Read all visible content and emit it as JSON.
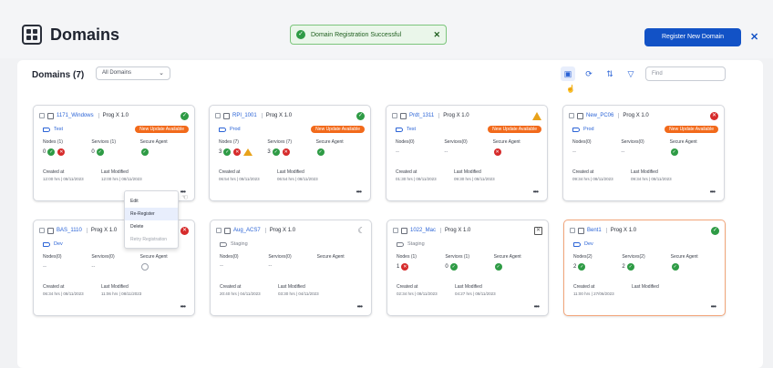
{
  "header": {
    "title": "Domains",
    "toast": "Domain Registration Successful",
    "register_label": "Register New Domain"
  },
  "toolbar": {
    "count_title": "Domains (7)",
    "filter_value": "All Domains",
    "find_placeholder": "Find"
  },
  "menu": {
    "items": [
      "Edit",
      "Re-Register",
      "Delete",
      "Retry Registration"
    ]
  },
  "labels": {
    "nodes": "Nodes",
    "services": "Services",
    "secure_agent": "Secure Agent",
    "created_at": "Created at",
    "last_modified": "Last Modified"
  },
  "cards": [
    {
      "name": "1171_Windows",
      "prog": "Prog X 1.0",
      "status": "ok",
      "tag": "Test",
      "update": "New Update Available",
      "nodes_label": "Nodes (1)",
      "services_label": "Services (1)",
      "agent_label": "Secure Agent",
      "nodes_val": "0",
      "services_val": "0",
      "created": "12:00 hrs | 08/11/2023",
      "modified": "12:00 hrs | 08/11/2023"
    },
    {
      "name": "RPI_1001",
      "prog": "Prog X 1.0",
      "status": "ok",
      "tag": "Prod",
      "update": "New Update Available",
      "nodes_label": "Nodes (7)",
      "services_label": "Services (7)",
      "agent_label": "Secure Agent",
      "nodes_val": "3",
      "services_val": "3",
      "created": "06:54 hrs | 08/11/2023",
      "modified": "06:54 hrs | 08/11/2023"
    },
    {
      "name": "Prdt_1311",
      "prog": "Prog X 1.0",
      "status": "warn",
      "tag": "Test",
      "update": "New Update Available",
      "nodes_label": "Nodes(0)",
      "services_label": "Services(0)",
      "agent_label": "Secure Agent",
      "nodes_val": "--",
      "services_val": "--",
      "created": "01:30 hrs | 08/11/2023",
      "modified": "09:30 hrs | 08/11/2023"
    },
    {
      "name": "New_PC06",
      "prog": "Prog X 1.0",
      "status": "err",
      "tag": "Prod",
      "update": "New Update Available",
      "nodes_label": "Nodes(0)",
      "services_label": "Services(0)",
      "agent_label": "Secure Agent",
      "nodes_val": "--",
      "services_val": "--",
      "created": "09:34 hrs | 08/11/2023",
      "modified": "09:34 hrs | 08/11/2023"
    },
    {
      "name": "BAS_1110",
      "prog": "Prog X 1.0",
      "status": "err",
      "tag": "Dev",
      "update": "",
      "nodes_label": "Nodes(0)",
      "services_label": "Services(0)",
      "agent_label": "Secure Agent",
      "nodes_val": "--",
      "services_val": "--",
      "created": "06:34 hrs | 08/11/2023",
      "modified": "11:06 hrs | 08/11/2023"
    },
    {
      "name": "Aug_ACS7",
      "prog": "Prog X 1.0",
      "status": "moon",
      "tag": "Staging",
      "update": "",
      "nodes_label": "Nodes(0)",
      "services_label": "Services(0)",
      "agent_label": "Secure Agent",
      "nodes_val": "--",
      "services_val": "--",
      "created": "20:40 hrs | 04/11/2023",
      "modified": "03:30 hrs | 04/11/2023"
    },
    {
      "name": "1022_Mac",
      "prog": "Prog X 1.0",
      "status": "box",
      "tag": "Staging",
      "update": "",
      "nodes_label": "Nodes (1)",
      "services_label": "Services (1)",
      "agent_label": "Secure Agent",
      "nodes_val": "1",
      "services_val": "0",
      "created": "02:34 hrs | 08/11/2023",
      "modified": "04:27 hrs | 08/11/2023"
    },
    {
      "name": "Bent1",
      "prog": "Prog X 1.0",
      "status": "ok",
      "tag": "Dev",
      "update": "",
      "nodes_label": "Nodes(2)",
      "services_label": "Services(2)",
      "agent_label": "Secure Agent",
      "nodes_val": "2",
      "services_val": "2",
      "created": "11:00 hrs | 27/06/2023",
      "modified": ""
    }
  ]
}
